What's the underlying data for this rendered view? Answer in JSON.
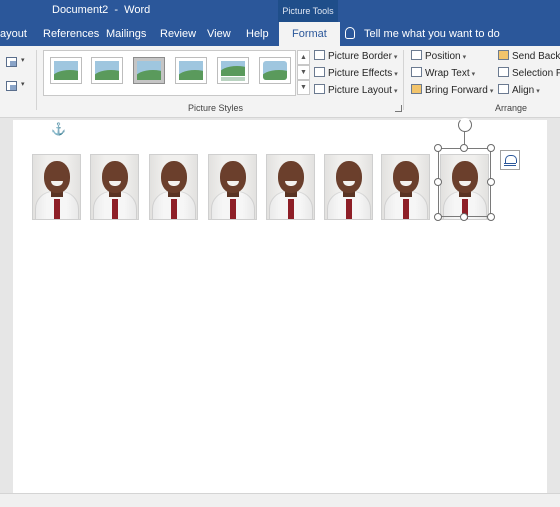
{
  "titlebar": {
    "title": "Document2  -  Word",
    "context_tab_group": "Picture Tools"
  },
  "tabs": [
    {
      "label": "ayout"
    },
    {
      "label": "References"
    },
    {
      "label": "Mailings"
    },
    {
      "label": "Review"
    },
    {
      "label": "View"
    },
    {
      "label": "Help"
    },
    {
      "label": "Format",
      "active": true
    }
  ],
  "tell_me": {
    "text": "Tell me what you want to do"
  },
  "ribbon": {
    "picture_styles": {
      "group_label": "Picture Styles",
      "styles": [
        {
          "icon": "style-simple-frame-icon"
        },
        {
          "icon": "style-simple-frame-white-icon"
        },
        {
          "icon": "style-beveled-matte-icon",
          "selected": true
        },
        {
          "icon": "style-drop-shadow-icon"
        },
        {
          "icon": "style-reflected-icon"
        },
        {
          "icon": "style-soft-edge-icon"
        }
      ],
      "commands": [
        {
          "label": "Picture Border",
          "icon": "picture-border-icon"
        },
        {
          "label": "Picture Effects",
          "icon": "picture-effects-icon"
        },
        {
          "label": "Picture Layout",
          "icon": "picture-layout-icon"
        }
      ]
    },
    "arrange": {
      "group_label": "Arrange",
      "commands": [
        {
          "label": "Position",
          "icon": "position-icon"
        },
        {
          "label": "Wrap Text",
          "icon": "wrap-text-icon"
        },
        {
          "label": "Bring Forward",
          "icon": "bring-forward-icon"
        },
        {
          "label": "Send Backw",
          "icon": "send-backward-icon"
        },
        {
          "label": "Selection Pa",
          "icon": "selection-pane-icon"
        },
        {
          "label": "Align",
          "icon": "align-icon"
        }
      ]
    }
  },
  "document": {
    "pictures": [
      {
        "name": "portrait"
      },
      {
        "name": "portrait"
      },
      {
        "name": "portrait"
      },
      {
        "name": "portrait"
      },
      {
        "name": "portrait"
      },
      {
        "name": "portrait"
      },
      {
        "name": "portrait"
      },
      {
        "name": "portrait",
        "selected": true
      }
    ]
  },
  "colors": {
    "accent": "#2b579a",
    "ribbon_bg": "#f3f3f3",
    "doc_bg": "#e6e6e6"
  }
}
